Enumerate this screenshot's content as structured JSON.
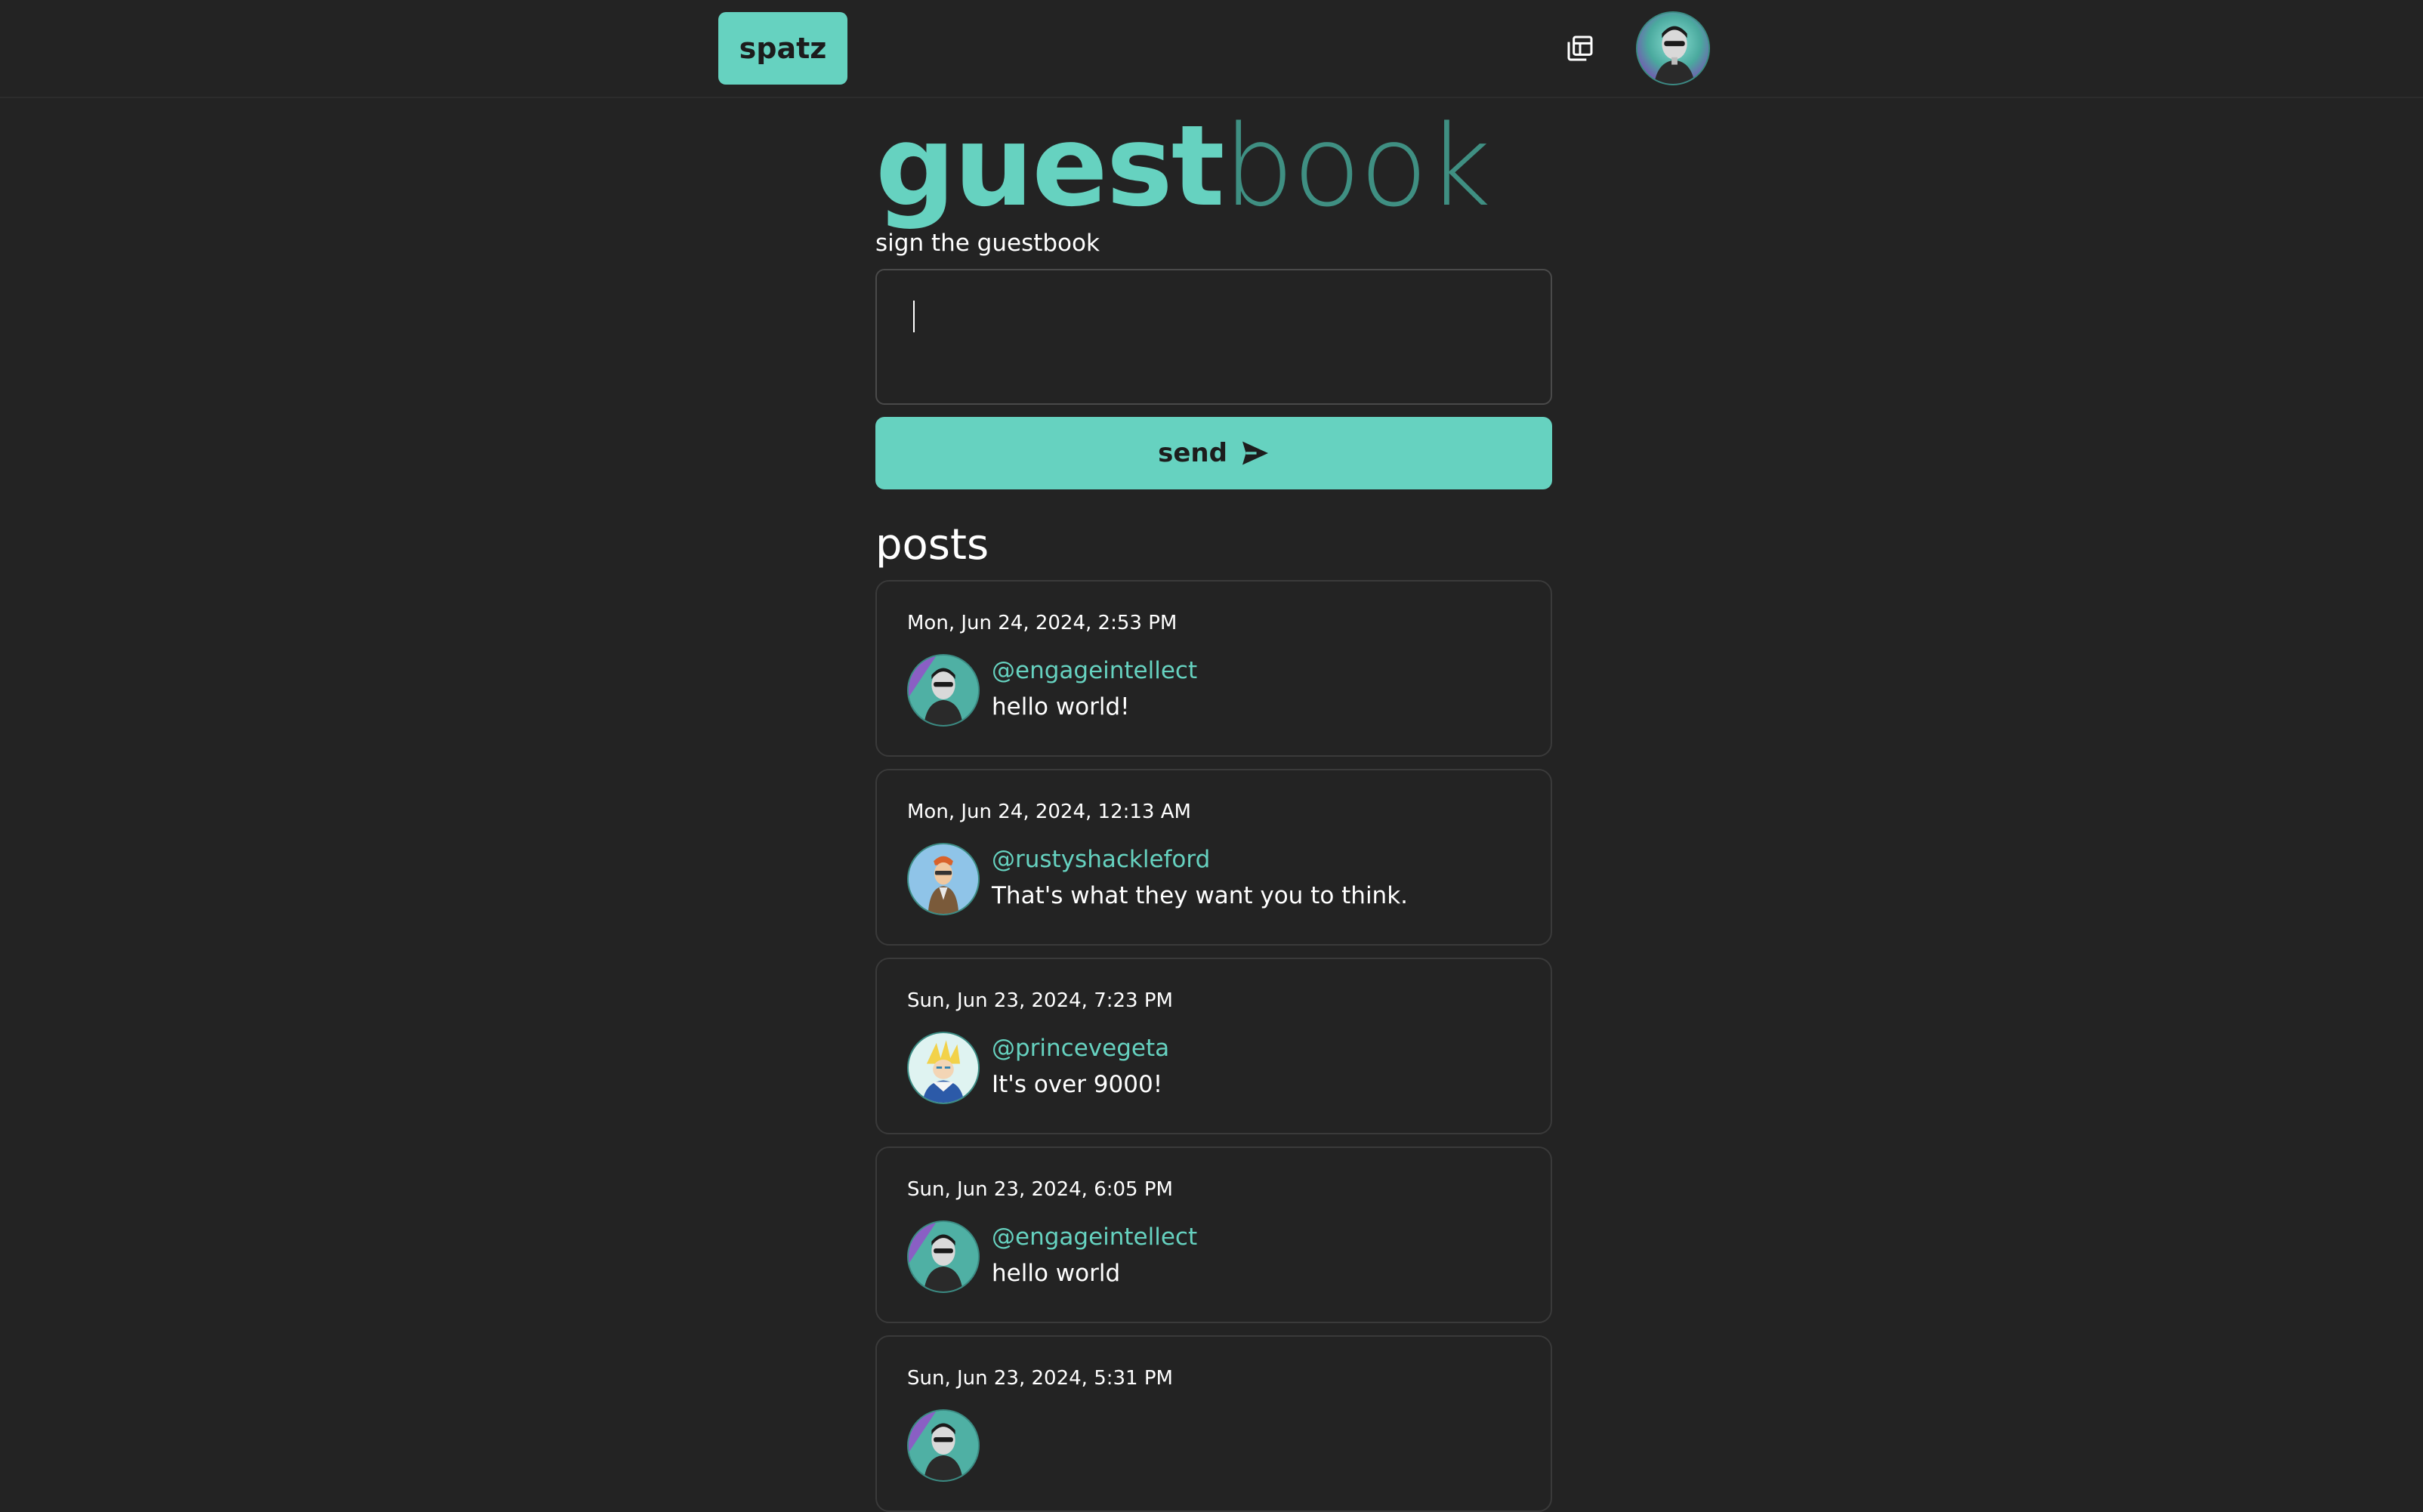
{
  "header": {
    "brand_label": "spatz",
    "windows_icon": "windows-stack-icon",
    "avatar_alt": "user avatar"
  },
  "guestbook": {
    "title_bold": "guest",
    "title_light": "book",
    "sign_label": "sign the guestbook",
    "input_value": "",
    "send_label": "send",
    "send_icon": "paper-plane-icon"
  },
  "posts_title": "posts",
  "posts": [
    {
      "time": "Mon, Jun 24, 2024, 2:53 PM",
      "user": "@engageintellect",
      "message": "hello world!",
      "avatar": "cyborg"
    },
    {
      "time": "Mon, Jun 24, 2024, 12:13 AM",
      "user": "@rustyshackleford",
      "message": "That's what they want you to think.",
      "avatar": "rusty"
    },
    {
      "time": "Sun, Jun 23, 2024, 7:23 PM",
      "user": "@princevegeta",
      "message": "It's over 9000!",
      "avatar": "vegeta"
    },
    {
      "time": "Sun, Jun 23, 2024, 6:05 PM",
      "user": "@engageintellect",
      "message": "hello world",
      "avatar": "cyborg"
    },
    {
      "time": "Sun, Jun 23, 2024, 5:31 PM",
      "user": "",
      "message": "",
      "avatar": "cyborg"
    }
  ],
  "colors": {
    "accent": "#66d2c0",
    "accent_dark": "#3f8f82",
    "background": "#232323"
  }
}
